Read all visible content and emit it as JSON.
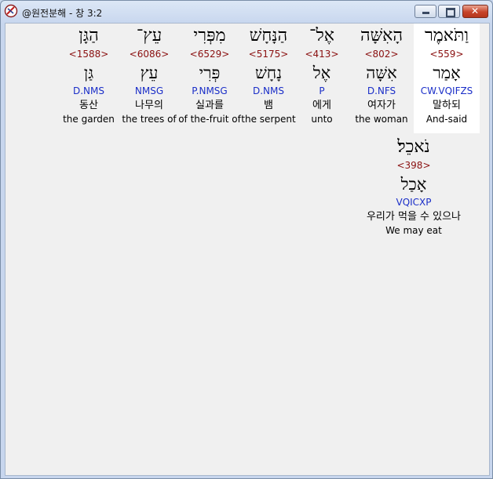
{
  "window": {
    "title": "@원전분해 - 창 3:2",
    "controls": {
      "minimize": "minimize",
      "maximize": "maximize",
      "close": "✕"
    }
  },
  "words": [
    {
      "hebrew": "וַתֹּאמֶר",
      "strong": "<559>",
      "lemma": "אָמַר",
      "morph": "CW.VQIFZS",
      "korean": "말하되",
      "english": "And-said"
    },
    {
      "hebrew": "הָאִשָּׁה",
      "strong": "<802>",
      "lemma": "אִשָּׁה",
      "morph": "D.NFS",
      "korean": "여자가",
      "english": "the woman"
    },
    {
      "hebrew": "אֶל־",
      "strong": "<413>",
      "lemma": "אֶל",
      "morph": "P",
      "korean": "에게",
      "english": "unto"
    },
    {
      "hebrew": "הַנָּחָשׁ",
      "strong": "<5175>",
      "lemma": "נָחָשׁ",
      "morph": "D.NMS",
      "korean": "뱀",
      "english": "the serpent"
    },
    {
      "hebrew": "מִפְּרִי",
      "strong": "<6529>",
      "lemma": "פְּרִי",
      "morph": "P.NMSG",
      "korean": "실과를",
      "english": "of the-fruit of"
    },
    {
      "hebrew": "עֵץ־",
      "strong": "<6086>",
      "lemma": "עֵץ",
      "morph": "NMSG",
      "korean": "나무의",
      "english": "the trees of"
    },
    {
      "hebrew": "הַגָּן",
      "strong": "<1588>",
      "lemma": "גַּן",
      "morph": "D.NMS",
      "korean": "동산",
      "english": "the garden"
    },
    {
      "hebrew": "נֹאכֵל׃",
      "strong": "<398>",
      "lemma": "אָכַל",
      "morph": "VQICXP",
      "korean": "우리가 먹을 수 있으나",
      "english": "We may eat"
    }
  ]
}
